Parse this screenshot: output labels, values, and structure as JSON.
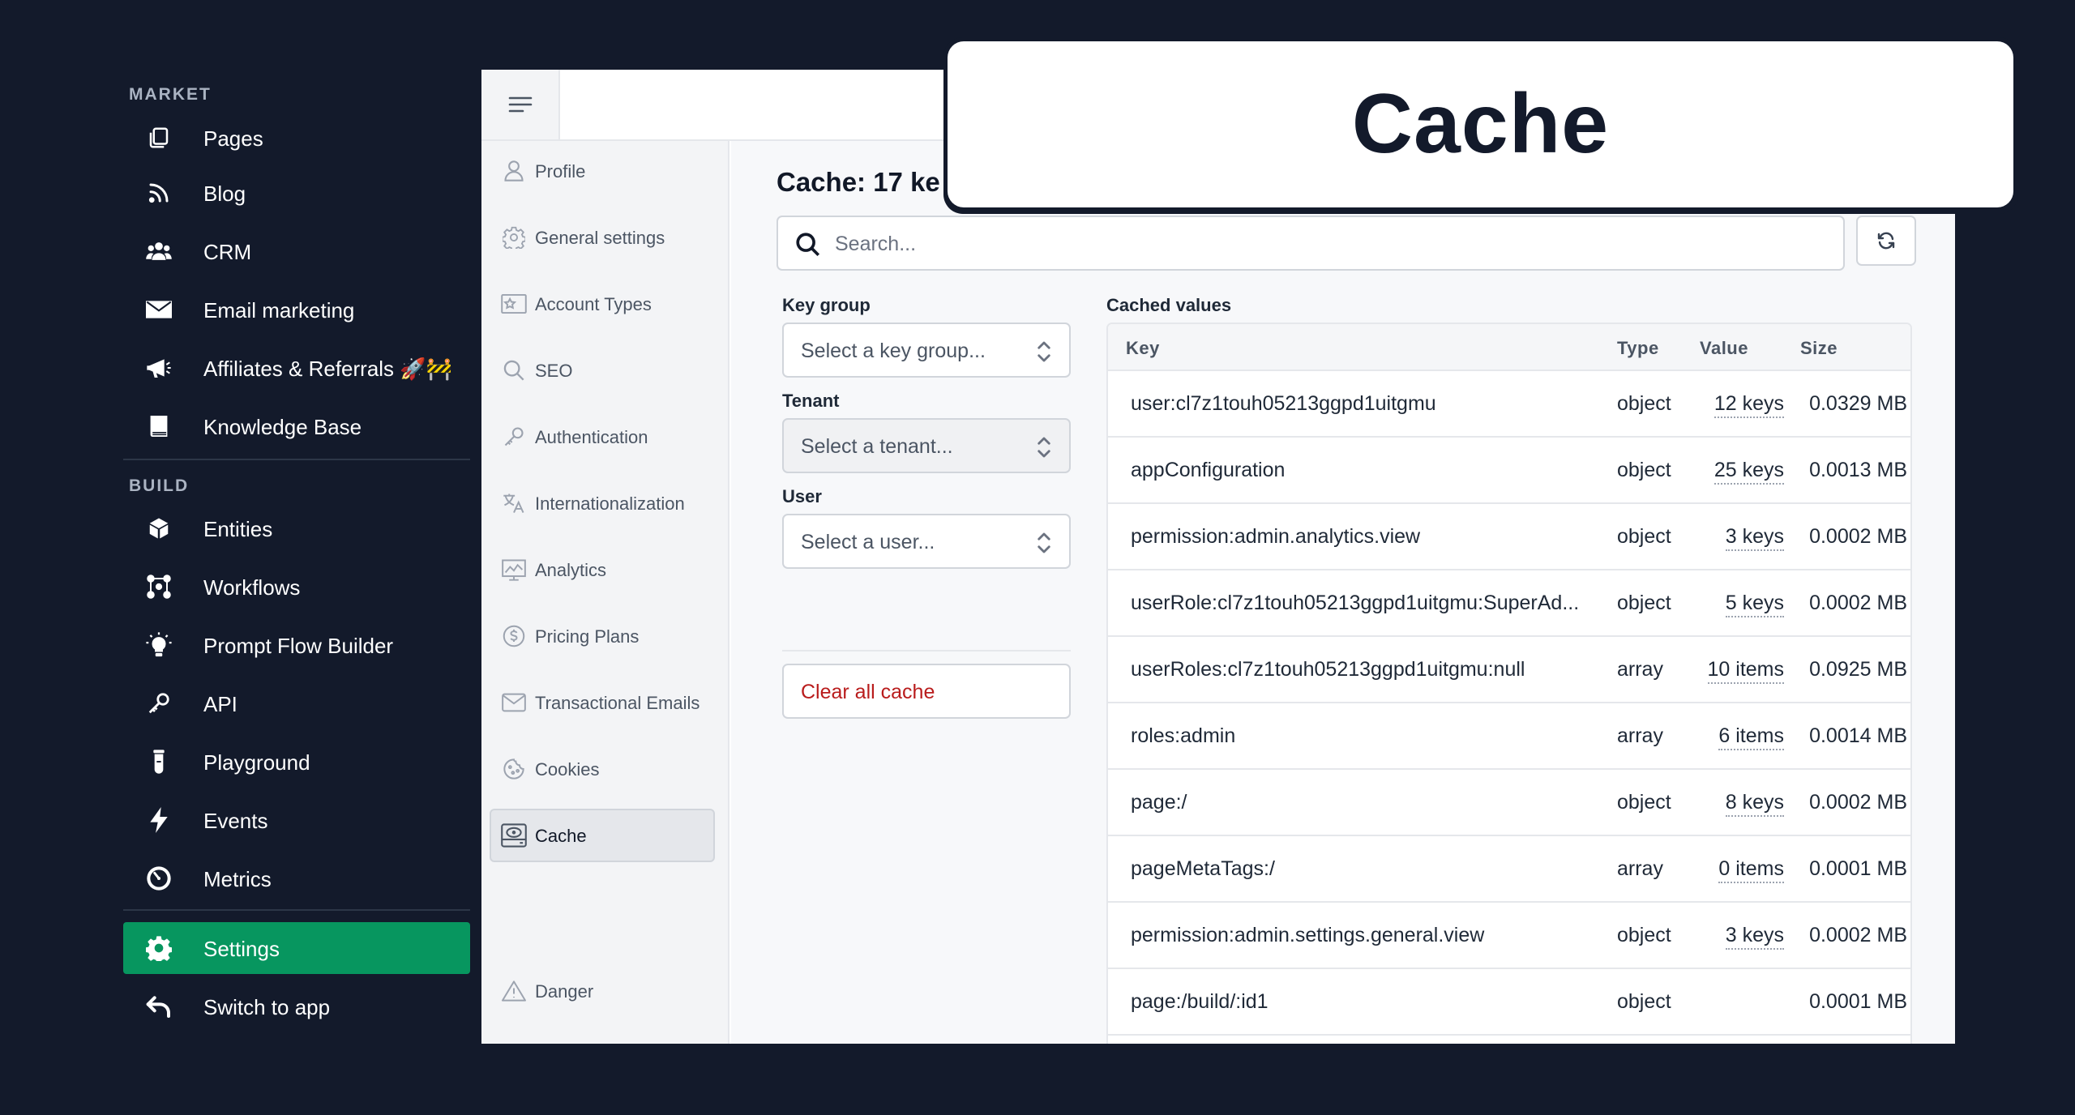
{
  "sidebar": {
    "sections": [
      {
        "title": "MARKET"
      },
      {
        "title": "BUILD"
      }
    ],
    "market_items": [
      {
        "label": "Pages",
        "icon": "pages-icon"
      },
      {
        "label": "Blog",
        "icon": "rss-icon"
      },
      {
        "label": "CRM",
        "icon": "users-icon"
      },
      {
        "label": "Email marketing",
        "icon": "envelope-icon"
      },
      {
        "label": "Affiliates & Referrals 🚀🚧",
        "icon": "megaphone-icon"
      },
      {
        "label": "Knowledge Base",
        "icon": "book-icon"
      }
    ],
    "build_items": [
      {
        "label": "Entities",
        "icon": "cube-icon"
      },
      {
        "label": "Workflows",
        "icon": "workflow-icon"
      },
      {
        "label": "Prompt Flow Builder",
        "icon": "lightbulb-icon"
      },
      {
        "label": "API",
        "icon": "key-icon"
      },
      {
        "label": "Playground",
        "icon": "test-tube-icon"
      },
      {
        "label": "Events",
        "icon": "bolt-icon"
      },
      {
        "label": "Metrics",
        "icon": "stopwatch-icon"
      }
    ],
    "bottom_items": [
      {
        "label": "Settings",
        "icon": "gear-icon",
        "active": true
      },
      {
        "label": "Switch to app",
        "icon": "undo-arrow-icon"
      }
    ]
  },
  "settings_nav": {
    "items": [
      {
        "label": "Profile",
        "icon": "user-icon"
      },
      {
        "label": "General settings",
        "icon": "gear-icon"
      },
      {
        "label": "Account Types",
        "icon": "star-card-icon"
      },
      {
        "label": "SEO",
        "icon": "search-icon"
      },
      {
        "label": "Authentication",
        "icon": "key-icon"
      },
      {
        "label": "Internationalization",
        "icon": "translate-icon"
      },
      {
        "label": "Analytics",
        "icon": "chart-icon"
      },
      {
        "label": "Pricing Plans",
        "icon": "dollar-icon"
      },
      {
        "label": "Transactional Emails",
        "icon": "envelope-icon"
      },
      {
        "label": "Cookies",
        "icon": "cookie-icon"
      },
      {
        "label": "Cache",
        "icon": "hard-drive-icon",
        "active": true
      }
    ],
    "danger": {
      "label": "Danger",
      "icon": "warning-icon"
    }
  },
  "main": {
    "heading": "Cache: 17 ke",
    "search": {
      "placeholder": "Search..."
    },
    "filters": {
      "key_group": {
        "label": "Key group",
        "placeholder": "Select a key group..."
      },
      "tenant": {
        "label": "Tenant",
        "placeholder": "Select a tenant..."
      },
      "user": {
        "label": "User",
        "placeholder": "Select a user..."
      }
    },
    "clear_button": "Clear all cache",
    "table": {
      "title": "Cached values",
      "columns": {
        "key": "Key",
        "type": "Type",
        "value": "Value",
        "size": "Size"
      },
      "rows": [
        {
          "key": "user:cl7z1touh05213ggpd1uitgmu",
          "type": "object",
          "value": "12 keys",
          "size": "0.0329 MB"
        },
        {
          "key": "appConfiguration",
          "type": "object",
          "value": "25 keys",
          "size": "0.0013 MB"
        },
        {
          "key": "permission:admin.analytics.view",
          "type": "object",
          "value": "3 keys",
          "size": "0.0002 MB"
        },
        {
          "key": "userRole:cl7z1touh05213ggpd1uitgmu:SuperAd...",
          "type": "object",
          "value": "5 keys",
          "size": "0.0002 MB"
        },
        {
          "key": "userRoles:cl7z1touh05213ggpd1uitgmu:null",
          "type": "array",
          "value": "10 items",
          "size": "0.0925 MB"
        },
        {
          "key": "roles:admin",
          "type": "array",
          "value": "6 items",
          "size": "0.0014 MB"
        },
        {
          "key": "page:/",
          "type": "object",
          "value": "8 keys",
          "size": "0.0002 MB"
        },
        {
          "key": "pageMetaTags:/",
          "type": "array",
          "value": "0 items",
          "size": "0.0001 MB"
        },
        {
          "key": "permission:admin.settings.general.view",
          "type": "object",
          "value": "3 keys",
          "size": "0.0002 MB"
        },
        {
          "key": "page:/build/:id1",
          "type": "object",
          "value": "",
          "size": "0.0001 MB"
        }
      ]
    }
  },
  "overlay": {
    "title": "Cache"
  },
  "colors": {
    "background": "#131a2b",
    "accent": "#07965f",
    "danger": "#b91c1c"
  }
}
